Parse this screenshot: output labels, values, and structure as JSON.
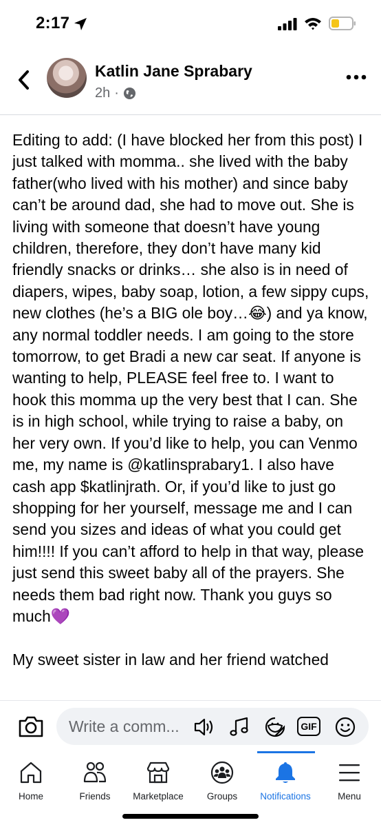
{
  "status_bar": {
    "time": "2:17"
  },
  "post": {
    "author": "Katlin Jane Sprabary",
    "time_ago": "2h",
    "separator": "·",
    "text_part1": "Editing to add: (I have blocked her from this post) I just talked with momma.. she lived with the baby father(who lived with his mother) and since baby can’t be around dad, she had to move out. She is living with someone that doesn’t have young children, therefore, they don’t have many kid friendly snacks or drinks… she also is in need of diapers, wipes, baby soap, lotion, a few sippy cups, new clothes (he’s a BIG ole boy…",
    "laugh_emoji": "😂",
    "text_part2": ") and ya know, any normal toddler needs. I am going to the store tomorrow, to get Bradi a new car seat. If anyone is wanting to help, PLEASE feel free to. I want to hook this momma up the very best that I can. She is in high school, while trying to raise a baby, on her very own. If you’d like to help, you can Venmo me, my name is @katlinsprabary1. I also have cash app $katlinjrath. Or, if you’d like to just go shopping for her yourself, message me and I can send you sizes and ideas of what you could get him!!!! If you can’t afford to help in that way, please just send this sweet baby all of the prayers. She needs them bad right now. Thank you guys so much",
    "heart_emoji": "💜",
    "text_second": "My sweet sister in law and her friend watched"
  },
  "comment_bar": {
    "placeholder": "Write a comm...",
    "gif_label": "GIF"
  },
  "nav": {
    "items": [
      {
        "label": "Home"
      },
      {
        "label": "Friends"
      },
      {
        "label": "Marketplace"
      },
      {
        "label": "Groups"
      },
      {
        "label": "Notifications"
      },
      {
        "label": "Menu"
      }
    ],
    "active_color": "#1b74e4"
  }
}
